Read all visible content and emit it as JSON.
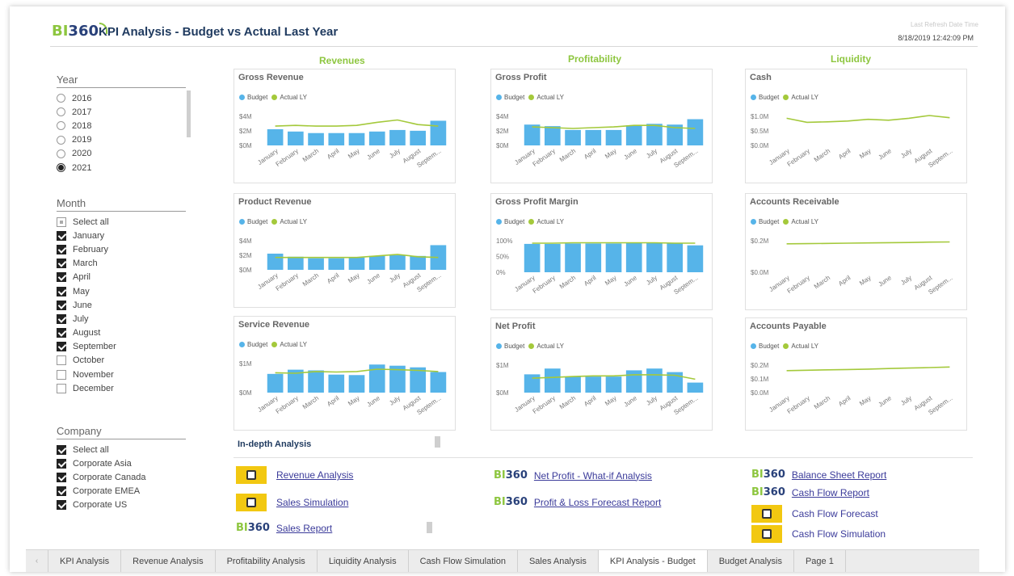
{
  "header": {
    "logo_bi": "BI",
    "logo_num": "360",
    "title": "KPI Analysis - Budget vs Actual Last Year",
    "refresh_caption": "Last Refresh Date Time",
    "timestamp": "8/18/2019 12:42:09 PM"
  },
  "year_slicer": {
    "title": "Year",
    "items": [
      {
        "label": "2016",
        "selected": false
      },
      {
        "label": "2017",
        "selected": false
      },
      {
        "label": "2018",
        "selected": false
      },
      {
        "label": "2019",
        "selected": false
      },
      {
        "label": "2020",
        "selected": false
      },
      {
        "label": "2021",
        "selected": true
      }
    ]
  },
  "month_slicer": {
    "title": "Month",
    "items": [
      {
        "label": "Select all",
        "state": "partial"
      },
      {
        "label": "January",
        "state": "on"
      },
      {
        "label": "February",
        "state": "on"
      },
      {
        "label": "March",
        "state": "on"
      },
      {
        "label": "April",
        "state": "on"
      },
      {
        "label": "May",
        "state": "on"
      },
      {
        "label": "June",
        "state": "on"
      },
      {
        "label": "July",
        "state": "on"
      },
      {
        "label": "August",
        "state": "on"
      },
      {
        "label": "September",
        "state": "on"
      },
      {
        "label": "October",
        "state": "off"
      },
      {
        "label": "November",
        "state": "off"
      },
      {
        "label": "December",
        "state": "off"
      }
    ]
  },
  "company_slicer": {
    "title": "Company",
    "items": [
      {
        "label": "Select all",
        "state": "on"
      },
      {
        "label": "Corporate Asia",
        "state": "on"
      },
      {
        "label": "Corporate Canada",
        "state": "on"
      },
      {
        "label": "Corporate EMEA",
        "state": "on"
      },
      {
        "label": "Corporate US",
        "state": "on"
      }
    ]
  },
  "sections": {
    "revenues": "Revenues",
    "profitability": "Profitability",
    "liquidity": "Liquidity"
  },
  "legend": {
    "budget": "Budget",
    "actual": "Actual LY"
  },
  "colors": {
    "budget": "#56b4e9",
    "actual": "#a4c93b",
    "section": "#8dc63f",
    "link": "#3b3b9a",
    "powerbi": "#f2c811"
  },
  "chart_data": [
    {
      "id": "gross-revenue",
      "title": "Gross Revenue",
      "type": "bar",
      "categories": [
        "January",
        "February",
        "March",
        "April",
        "May",
        "June",
        "July",
        "August",
        "Septem..."
      ],
      "yticks": [
        "$4M",
        "$2M",
        "$0M"
      ],
      "ylim": [
        0,
        4.4
      ],
      "series": [
        {
          "name": "Budget",
          "values": [
            2.1,
            1.8,
            1.6,
            1.6,
            1.6,
            1.8,
            2.0,
            1.9,
            3.2
          ]
        },
        {
          "name": "Actual LY",
          "values": [
            2.5,
            2.6,
            2.5,
            2.5,
            2.6,
            3.0,
            3.3,
            2.7,
            2.5
          ]
        }
      ]
    },
    {
      "id": "product-revenue",
      "title": "Product Revenue",
      "type": "bar",
      "categories": [
        "January",
        "February",
        "March",
        "April",
        "May",
        "June",
        "July",
        "August",
        "Septem..."
      ],
      "yticks": [
        "$4M",
        "$2M",
        "$0M"
      ],
      "ylim": [
        0,
        4.4
      ],
      "series": [
        {
          "name": "Budget",
          "values": [
            2.1,
            1.7,
            1.5,
            1.5,
            1.6,
            1.8,
            1.9,
            1.8,
            3.2
          ]
        },
        {
          "name": "Actual LY",
          "values": [
            1.6,
            1.6,
            1.6,
            1.6,
            1.6,
            1.8,
            2.0,
            1.7,
            1.6
          ]
        }
      ]
    },
    {
      "id": "service-revenue",
      "title": "Service Revenue",
      "type": "bar",
      "categories": [
        "January",
        "February",
        "March",
        "April",
        "May",
        "June",
        "July",
        "August",
        "Septem..."
      ],
      "yticks": [
        "$1M",
        "$0M"
      ],
      "ylim": [
        0,
        1.45
      ],
      "series": [
        {
          "name": "Budget",
          "values": [
            0.8,
            0.98,
            0.95,
            0.77,
            0.75,
            1.2,
            1.15,
            1.08,
            0.88
          ]
        },
        {
          "name": "Actual LY",
          "values": [
            0.85,
            0.83,
            0.9,
            0.88,
            0.9,
            1.0,
            0.98,
            0.95,
            0.9
          ]
        }
      ]
    },
    {
      "id": "gross-profit",
      "title": "Gross Profit",
      "type": "bar",
      "categories": [
        "January",
        "February",
        "March",
        "April",
        "May",
        "June",
        "July",
        "August",
        "Septem..."
      ],
      "yticks": [
        "$4M",
        "$2M",
        "$0M"
      ],
      "ylim": [
        0,
        4.4
      ],
      "series": [
        {
          "name": "Budget",
          "values": [
            2.7,
            2.5,
            2.0,
            2.0,
            2.0,
            2.6,
            2.8,
            2.7,
            3.4
          ]
        },
        {
          "name": "Actual LY",
          "values": [
            2.4,
            2.3,
            2.2,
            2.3,
            2.4,
            2.6,
            2.6,
            2.3,
            2.2
          ]
        }
      ]
    },
    {
      "id": "gross-profit-margin",
      "title": "Gross Profit Margin",
      "type": "bar",
      "categories": [
        "January",
        "February",
        "March",
        "April",
        "May",
        "June",
        "July",
        "August",
        "Septem..."
      ],
      "yticks": [
        "100%",
        "50%",
        "0%"
      ],
      "ylim": [
        0,
        100
      ],
      "series": [
        {
          "name": "Budget",
          "values": [
            78,
            78,
            79,
            79,
            79,
            80,
            80,
            79,
            74
          ]
        },
        {
          "name": "Actual LY",
          "values": [
            80,
            80,
            81,
            81,
            81,
            81,
            81,
            80,
            80
          ]
        }
      ]
    },
    {
      "id": "net-profit",
      "title": "Net Profit",
      "type": "bar",
      "categories": [
        "January",
        "February",
        "March",
        "April",
        "May",
        "June",
        "July",
        "August",
        "Septem..."
      ],
      "yticks": [
        "$1M",
        "$0M"
      ],
      "ylim": [
        0,
        1.45
      ],
      "series": [
        {
          "name": "Budget",
          "values": [
            0.82,
            1.08,
            0.72,
            0.72,
            0.72,
            1.0,
            1.08,
            0.92,
            0.45
          ]
        },
        {
          "name": "Actual LY",
          "values": [
            0.65,
            0.68,
            0.72,
            0.75,
            0.75,
            0.8,
            0.8,
            0.78,
            0.6
          ]
        }
      ]
    },
    {
      "id": "cash",
      "title": "Cash",
      "type": "line",
      "categories": [
        "January",
        "February",
        "March",
        "April",
        "May",
        "June",
        "July",
        "August",
        "Septem..."
      ],
      "yticks": [
        "$1.0M",
        "$0.5M",
        "$0.0M"
      ],
      "ylim": [
        0,
        1.25
      ],
      "series": [
        {
          "name": "Actual LY",
          "values": [
            1.0,
            0.85,
            0.87,
            0.9,
            0.96,
            0.93,
            1.0,
            1.1,
            1.02
          ]
        }
      ]
    },
    {
      "id": "accounts-receivable",
      "title": "Accounts Receivable",
      "type": "line",
      "categories": [
        "January",
        "February",
        "March",
        "April",
        "May",
        "June",
        "July",
        "August",
        "Septem..."
      ],
      "yticks": [
        "$0.2M",
        "$0.0M"
      ],
      "ylim": [
        0,
        0.32
      ],
      "series": [
        {
          "name": "Actual LY",
          "values": [
            0.25,
            0.252,
            0.254,
            0.256,
            0.258,
            0.26,
            0.262,
            0.265,
            0.267
          ]
        }
      ]
    },
    {
      "id": "accounts-payable",
      "title": "Accounts Payable",
      "type": "line",
      "categories": [
        "January",
        "February",
        "March",
        "April",
        "May",
        "June",
        "July",
        "August",
        "Septem..."
      ],
      "yticks": [
        "$0.2M",
        "$0.1M",
        "$0.0M"
      ],
      "ylim": [
        0,
        0.25
      ],
      "series": [
        {
          "name": "Actual LY",
          "values": [
            0.17,
            0.173,
            0.176,
            0.179,
            0.182,
            0.186,
            0.19,
            0.194,
            0.198
          ]
        }
      ]
    }
  ],
  "indepth": {
    "title": "In-depth Analysis",
    "links": {
      "revenue_analysis": "Revenue Analysis",
      "sales_simulation": "Sales Simulation",
      "sales_report": "Sales Report",
      "net_profit": "Net Profit - What-if Analysis",
      "pl_forecast": "Profit & Loss Forecast Report",
      "balance_sheet": "Balance Sheet Report",
      "cash_flow_report": "Cash Flow Report",
      "cash_flow_forecast": "Cash Flow Forecast",
      "cash_flow_simulation": "Cash Flow Simulation"
    }
  },
  "tabs": [
    {
      "label": "KPI Analysis",
      "active": false
    },
    {
      "label": "Revenue Analysis",
      "active": false
    },
    {
      "label": "Profitability Analysis",
      "active": false
    },
    {
      "label": "Liquidity Analysis",
      "active": false
    },
    {
      "label": "Cash Flow Simulation",
      "active": false
    },
    {
      "label": "Sales Analysis",
      "active": false
    },
    {
      "label": "KPI Analysis - Budget",
      "active": true
    },
    {
      "label": "Budget Analysis",
      "active": false
    },
    {
      "label": "Page 1",
      "active": false
    }
  ],
  "tab_arrow": "‹"
}
